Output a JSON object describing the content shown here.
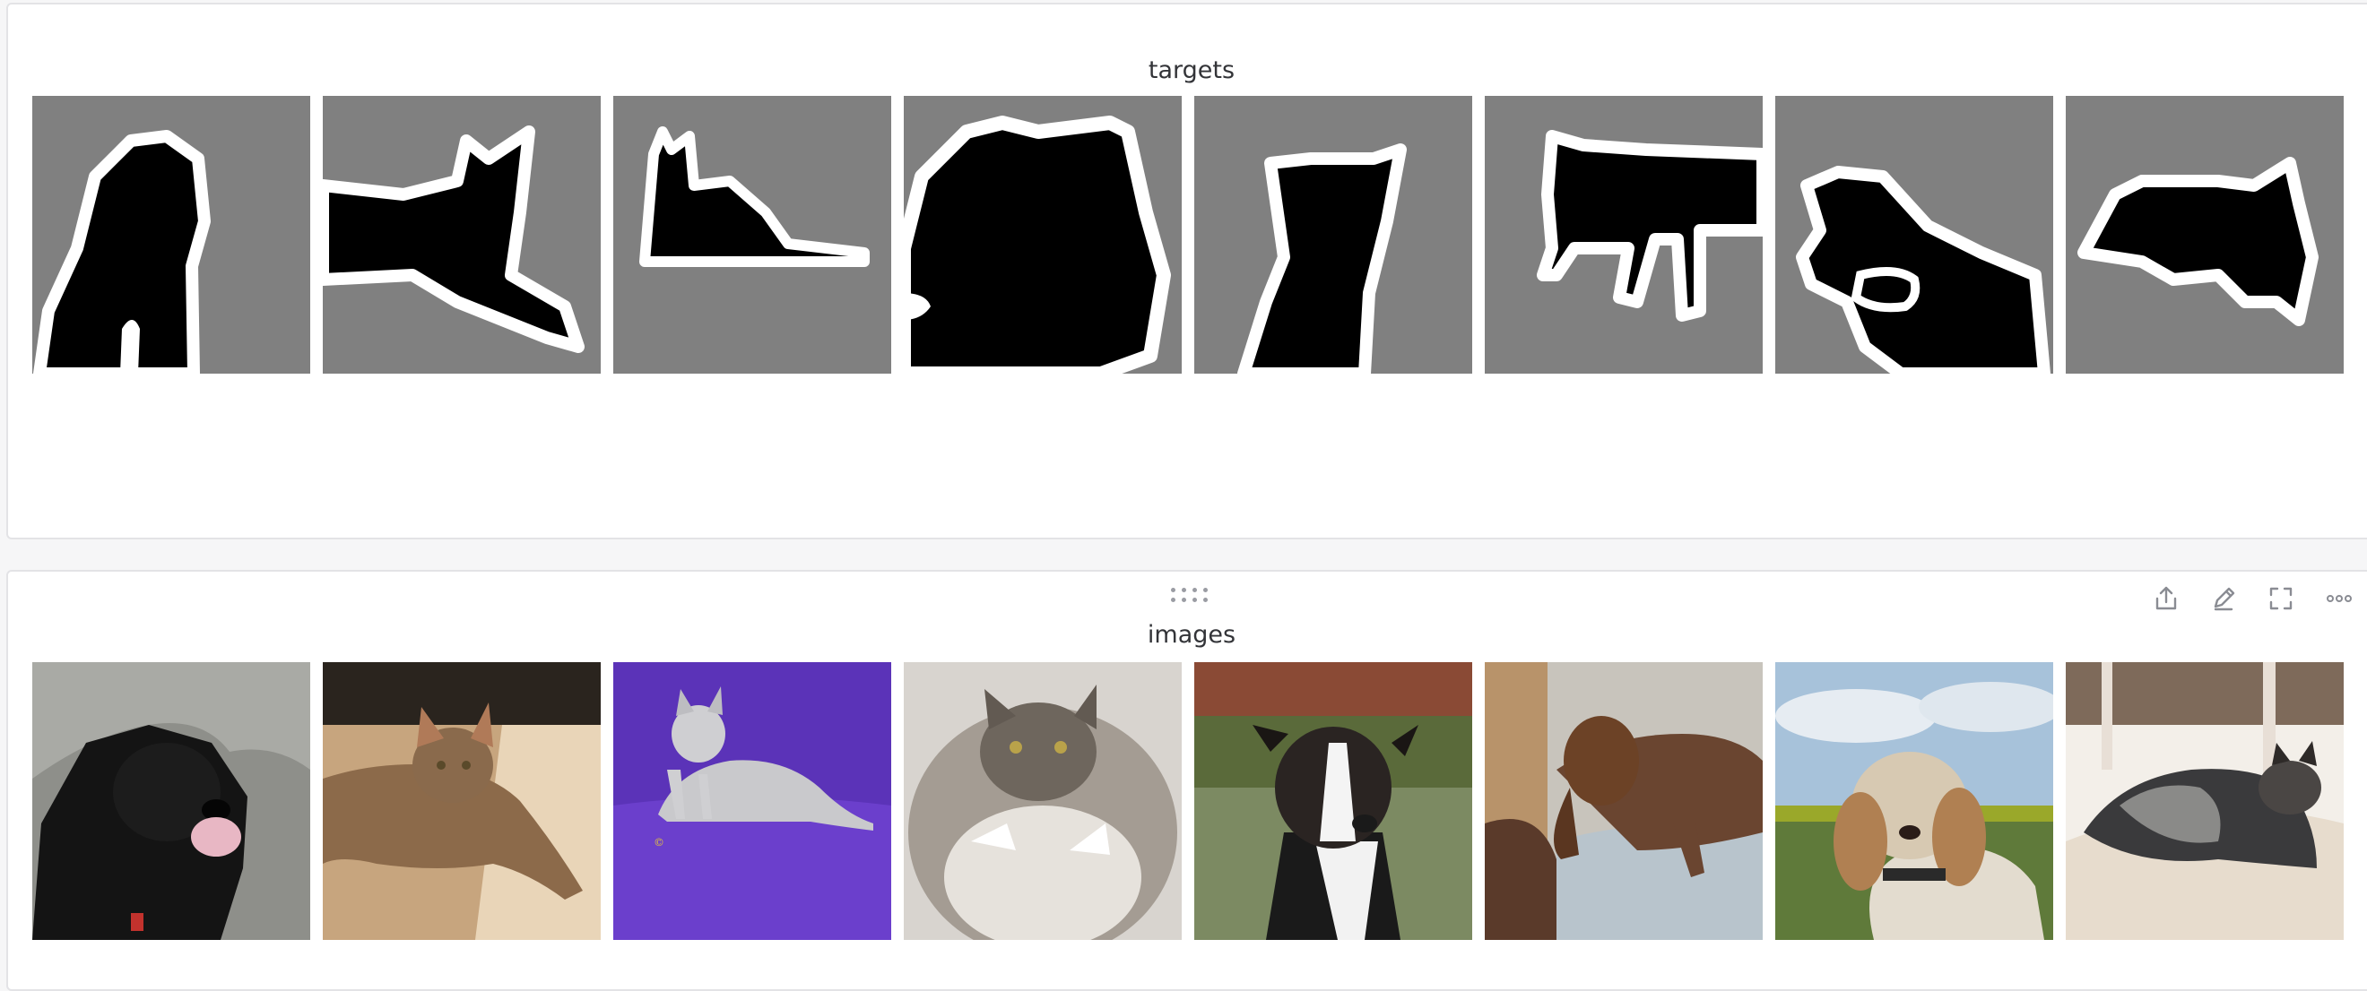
{
  "targets_panel": {
    "title": "targets"
  },
  "images_panel": {
    "title": "images"
  },
  "toolbar": {
    "icons": [
      "export-icon",
      "edit-icon",
      "fullscreen-icon",
      "more-icon"
    ]
  },
  "colors": {
    "mask_background": "#808080",
    "mask_foreground": "#000000",
    "mask_border": "#ffffff",
    "panel_border": "#e3e3e6",
    "title_text": "#333438",
    "icon_gray": "#8a8c93"
  },
  "target_masks": [
    {
      "id": "mask-1",
      "subject": "dog"
    },
    {
      "id": "mask-2",
      "subject": "cat"
    },
    {
      "id": "mask-3",
      "subject": "cat"
    },
    {
      "id": "mask-4",
      "subject": "cat"
    },
    {
      "id": "mask-5",
      "subject": "dog"
    },
    {
      "id": "mask-6",
      "subject": "dog"
    },
    {
      "id": "mask-7",
      "subject": "dog"
    },
    {
      "id": "mask-8",
      "subject": "dog"
    }
  ],
  "sample_images": [
    {
      "id": "image-1",
      "subject": "black newfoundland dog with tongue out"
    },
    {
      "id": "image-2",
      "subject": "brown cat lying on table"
    },
    {
      "id": "image-3",
      "subject": "silver tabby cat on purple backdrop"
    },
    {
      "id": "image-4",
      "subject": "fluffy grey cat on its back"
    },
    {
      "id": "image-5",
      "subject": "black and white pit bull puppy"
    },
    {
      "id": "image-6",
      "subject": "brown pointer dog on couch"
    },
    {
      "id": "image-7",
      "subject": "cocker spaniel outdoors"
    },
    {
      "id": "image-8",
      "subject": "keeshond dog lying on rug"
    }
  ]
}
